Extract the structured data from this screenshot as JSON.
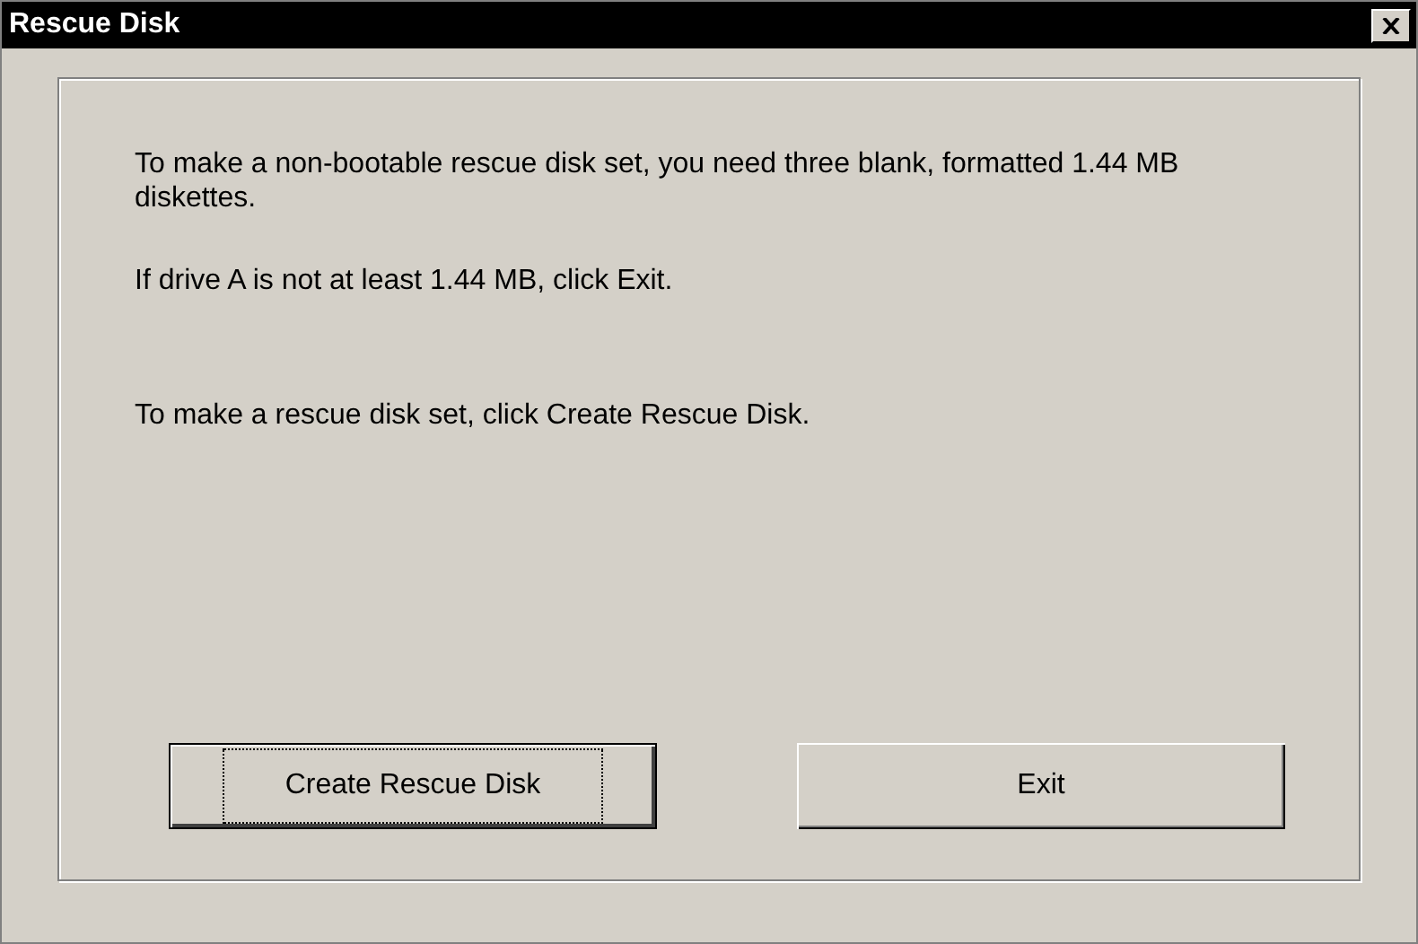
{
  "window": {
    "title": "Rescue Disk"
  },
  "paragraphs": [
    "To make a non-bootable rescue disk set, you need three blank, formatted 1.44 MB diskettes.",
    "If drive A is not at least 1.44 MB, click Exit.",
    "To make a rescue disk set, click Create Rescue Disk."
  ],
  "buttons": [
    {
      "label": "Create Rescue Disk",
      "selected": true
    },
    {
      "label": "Exit",
      "selected": false
    }
  ]
}
